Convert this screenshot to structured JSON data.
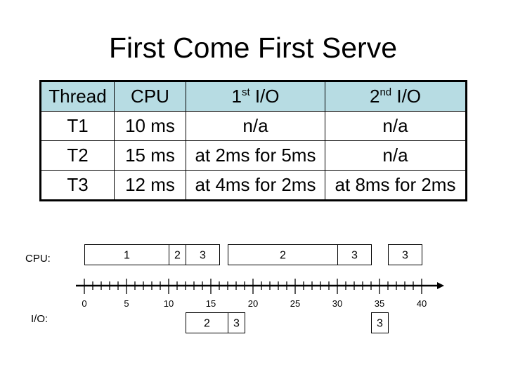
{
  "title": "First Come First Serve",
  "table": {
    "headers": [
      {
        "main": "Thread",
        "sup": "",
        "rest": ""
      },
      {
        "main": "CPU",
        "sup": "",
        "rest": ""
      },
      {
        "main": "1",
        "sup": "st",
        "rest": " I/O"
      },
      {
        "main": "2",
        "sup": "nd",
        "rest": " I/O"
      }
    ],
    "rows": [
      [
        "T1",
        "10 ms",
        "n/a",
        "n/a"
      ],
      [
        "T2",
        "15 ms",
        "at 2ms for 5ms",
        "n/a"
      ],
      [
        "T3",
        "12 ms",
        "at 4ms for 2ms",
        "at 8ms for 2ms"
      ]
    ],
    "header_color": "#B7DCE3"
  },
  "timeline": {
    "cpu_label": "CPU:",
    "io_label": "I/O:",
    "axis": {
      "min": 0,
      "max": 40,
      "major_step": 5,
      "minor_step": 1,
      "tick_labels": [
        "0",
        "5",
        "10",
        "15",
        "20",
        "25",
        "30",
        "35",
        "40"
      ]
    },
    "cpu_segments": [
      {
        "thread": "1",
        "start": 0,
        "end": 10
      },
      {
        "thread": "2",
        "start": 10,
        "end": 12
      },
      {
        "thread": "3",
        "start": 12,
        "end": 16
      },
      {
        "thread": "2",
        "start": 17,
        "end": 30
      },
      {
        "thread": "3",
        "start": 30,
        "end": 34
      },
      {
        "thread": "3",
        "start": 36,
        "end": 40
      }
    ],
    "io_segments": [
      {
        "thread": "2",
        "start": 12,
        "end": 17
      },
      {
        "thread": "3",
        "start": 17,
        "end": 19
      },
      {
        "thread": "3",
        "start": 34,
        "end": 36
      }
    ]
  }
}
